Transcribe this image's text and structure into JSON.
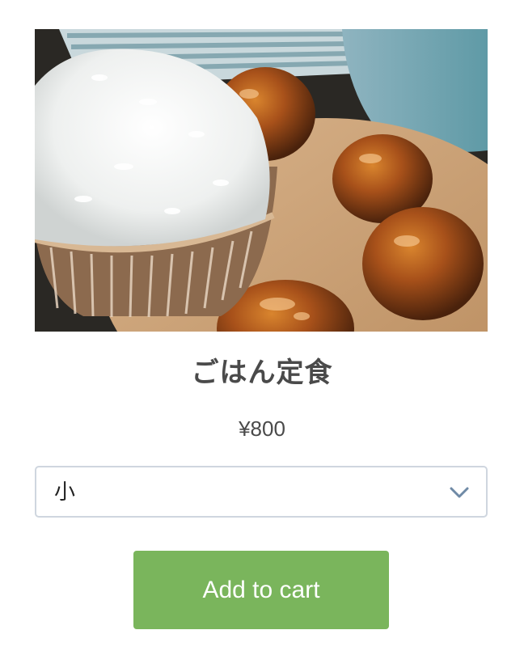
{
  "product": {
    "title": "ごはん定食",
    "price": "¥800",
    "image_alt": "rice bowl with glazed meatballs",
    "size_select": {
      "selected": "小"
    },
    "add_to_cart_label": "Add to cart"
  },
  "colors": {
    "button": "#7ab55c",
    "text": "#4a4a4a",
    "select_border": "#cfd6df",
    "chevron": "#6f8aa6"
  },
  "icons": {
    "select": "chevron-down-icon"
  }
}
